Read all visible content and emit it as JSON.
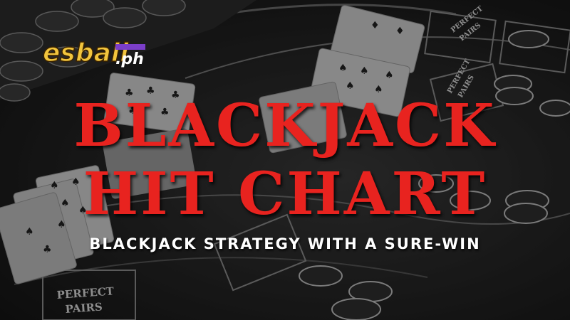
{
  "logo": {
    "main": "esball",
    "suffix": ".ph"
  },
  "title": {
    "line1": "BLACKJACK",
    "line2": "HIT CHART"
  },
  "subtitle": "BLACKJACK STRATEGY WITH A SURE-WIN",
  "table_labels": {
    "perfect_pairs": "PERFECT PAIRS",
    "perfect": "PERFECT",
    "pairs": "PAIRS"
  },
  "colors": {
    "title": "#e8231f",
    "subtitle": "#ffffff",
    "logo": "#f2c53d"
  }
}
